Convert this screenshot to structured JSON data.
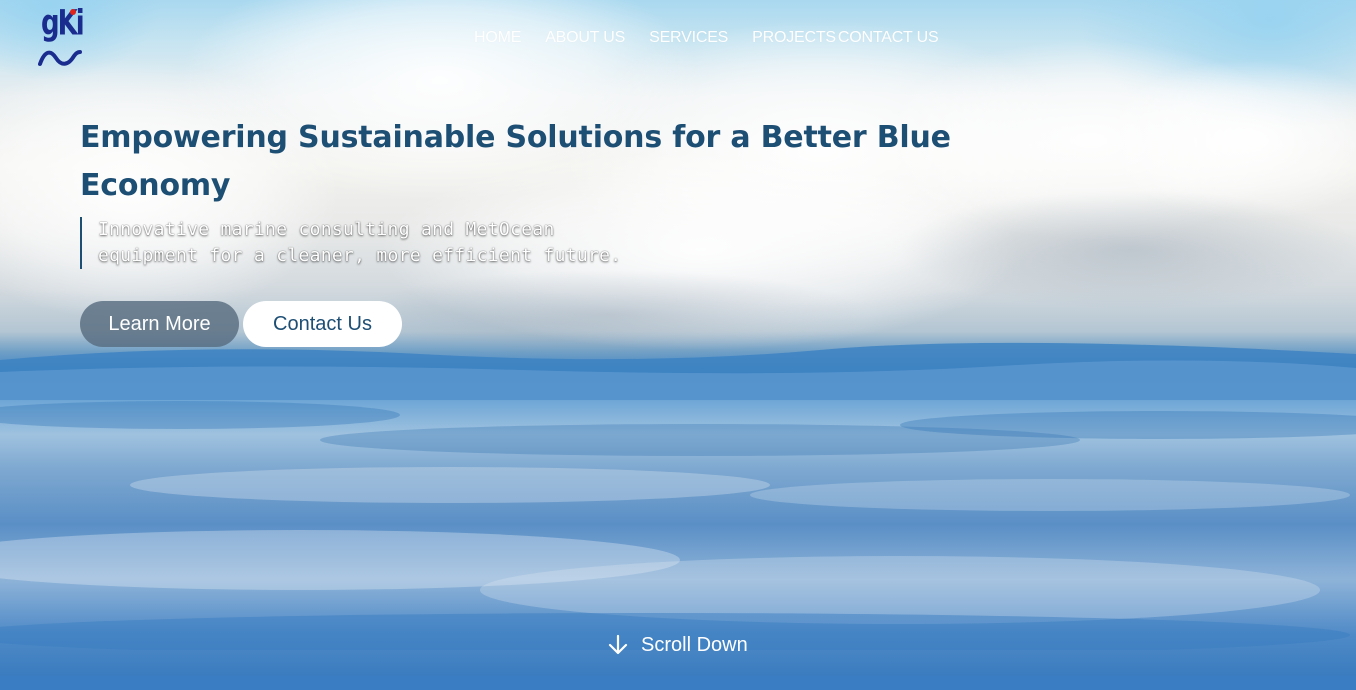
{
  "brand": {
    "logo_text": "gKi"
  },
  "nav": {
    "items": [
      {
        "label": "HOME"
      },
      {
        "label": "ABOUT US"
      },
      {
        "label": "SERVICES"
      },
      {
        "label": "PROJECTS"
      },
      {
        "label": "CONTACT US"
      }
    ]
  },
  "hero": {
    "headline": "Empowering Sustainable Solutions for a Better Blue Economy",
    "tagline_line1": "Innovative marine consulting and MetOcean",
    "tagline_line2": "equipment for a cleaner, more efficient future.",
    "learn_more_label": "Learn More",
    "contact_label": "Contact Us",
    "scroll_label": "Scroll Down"
  },
  "colors": {
    "heading": "#1d4e74",
    "nav_text": "#ffffff",
    "logo_blue": "#1a2d8f",
    "logo_red": "#e0241b",
    "learn_button_bg": "#586d80",
    "contact_button_bg": "#ffffff"
  },
  "icons": {
    "scroll": "arrow-down-icon"
  }
}
